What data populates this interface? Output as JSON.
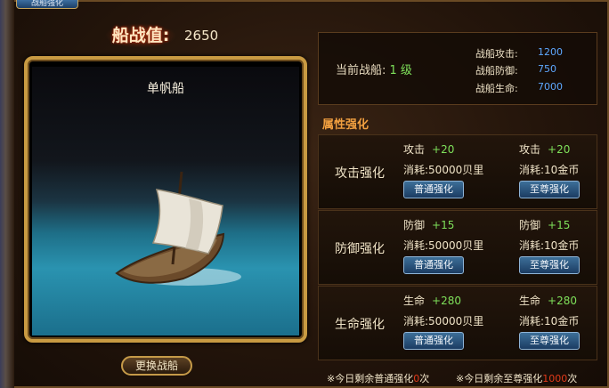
{
  "window": {
    "title": "战船强化"
  },
  "combat_value": {
    "label": "船战值:",
    "value": "2650"
  },
  "ship": {
    "name": "单帆船",
    "change_label": "更换战船"
  },
  "current": {
    "label": "当前战船:",
    "level": "1 级",
    "stats": [
      {
        "label": "战船攻击:",
        "value": "1200"
      },
      {
        "label": "战船防御:",
        "value": "750"
      },
      {
        "label": "战船生命:",
        "value": "7000"
      }
    ]
  },
  "attr_header": "属性强化",
  "enhance": [
    {
      "label": "攻击强化",
      "normal": {
        "stat": "攻击",
        "plus": "+20",
        "cost_label": "消耗:",
        "cost": "50000贝里",
        "button": "普通强化"
      },
      "supreme": {
        "stat": "攻击",
        "plus": "+20",
        "cost_label": "消耗:",
        "cost": "10金币",
        "button": "至尊强化"
      }
    },
    {
      "label": "防御强化",
      "normal": {
        "stat": "防御",
        "plus": "+15",
        "cost_label": "消耗:",
        "cost": "50000贝里",
        "button": "普通强化"
      },
      "supreme": {
        "stat": "防御",
        "plus": "+15",
        "cost_label": "消耗:",
        "cost": "10金币",
        "button": "至尊强化"
      }
    },
    {
      "label": "生命强化",
      "normal": {
        "stat": "生命",
        "plus": "+280",
        "cost_label": "消耗:",
        "cost": "50000贝里",
        "button": "普通强化"
      },
      "supreme": {
        "stat": "生命",
        "plus": "+280",
        "cost_label": "消耗:",
        "cost": "10金币",
        "button": "至尊强化"
      }
    }
  ],
  "footer": {
    "normal_prefix": "※今日剩余普通强化",
    "normal_count": "0",
    "normal_suffix": "次",
    "supreme_prefix": "※今日剩余至尊强化",
    "supreme_count": "1000",
    "supreme_suffix": "次"
  }
}
